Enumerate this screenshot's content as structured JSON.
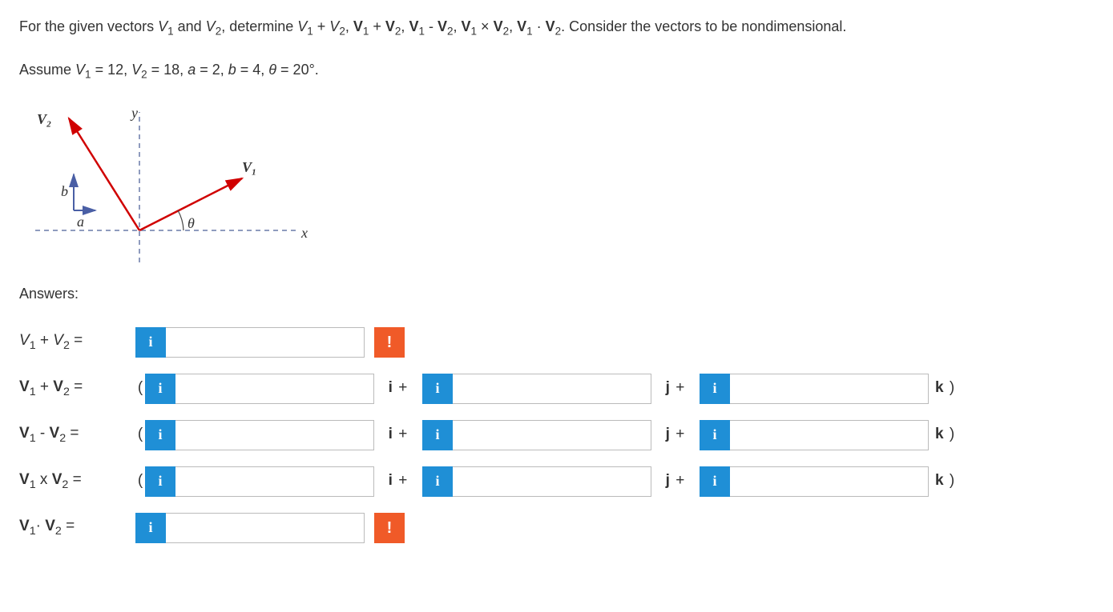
{
  "problem_text_parts": {
    "a": "For the given vectors ",
    "b": " and ",
    "c": ", determine ",
    "d": ". Consider the vectors to be nondimensional."
  },
  "vectors": {
    "V1": "V",
    "V1s": "1",
    "V2": "V",
    "V2s": "2"
  },
  "expr": {
    "sum_mag": "V₁ + V₂",
    "sum_vec": "V₁ + V₂",
    "diff_vec": "V₁ - V₂",
    "cross_vec": "V₁ × V₂",
    "dot_vec": "V₁ · V₂"
  },
  "assume": {
    "prefix": "Assume ",
    "v1": "V₁ = 12",
    "v2": "V₂ = 18",
    "a": "a = 2",
    "b": "b = 4",
    "theta": "θ = 20°",
    "period": "."
  },
  "figure": {
    "V1": "V₁",
    "V2": "V₂",
    "theta": "θ",
    "a": "a",
    "b": "b",
    "x": "x",
    "y": "y"
  },
  "answers_label": "Answers:",
  "rows": {
    "r1": {
      "label": "V₁ + V₂ ="
    },
    "r2": {
      "label": "V₁ + V₂ ="
    },
    "r3": {
      "label": "V₁ - V₂ ="
    },
    "r4": {
      "label": "V₁ x V₂ ="
    },
    "r5": {
      "label_a": "V₁",
      "label_dot": "·",
      "label_b": " V₂ ="
    }
  },
  "badges": {
    "info": "i",
    "warn": "!"
  },
  "units": {
    "i_plus": "i +",
    "j_plus": "j +",
    "k_close": "k )"
  },
  "paren_open": "("
}
